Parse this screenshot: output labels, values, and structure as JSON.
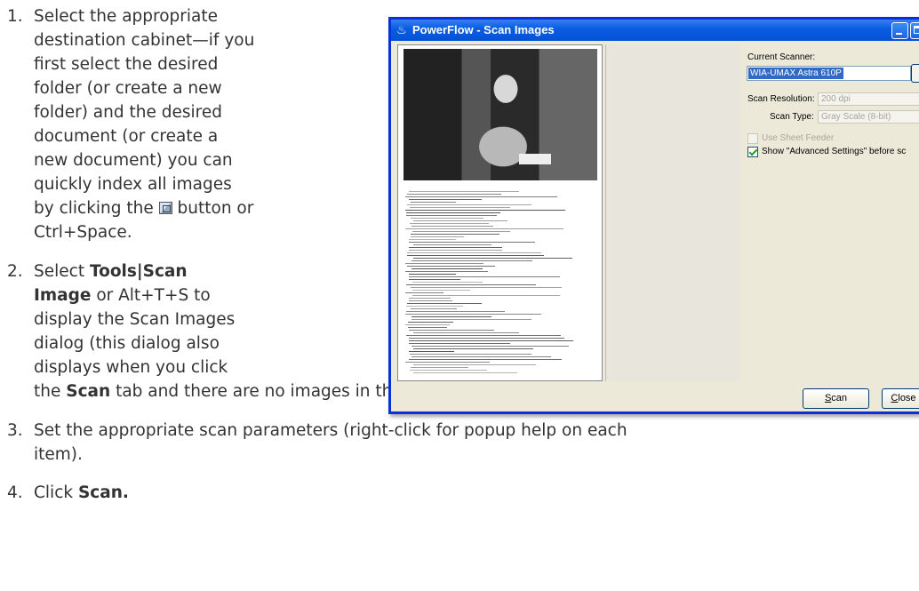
{
  "steps": [
    {
      "number": "1.",
      "lines": [
        "Select the appropriate",
        "destination cabinet—if you",
        "first select the desired",
        "folder (or create a new",
        "folder) and the desired",
        "document (or create a",
        "new document) you can",
        "quickly index all images"
      ],
      "line9_a": "by clicking the ",
      "line9_icon": "index-icon",
      "line9_b": " button or",
      "line10": "Ctrl+Space."
    },
    {
      "number": "2.",
      "l1_a": "Select ",
      "l1_bold": "Tools|Scan",
      "l2_bold": "Image",
      "l2_b": " or Alt+T+S to",
      "l3": "display the Scan Images",
      "l4": "dialog (this dialog also",
      "l5": "displays when you click",
      "l6_a": "the ",
      "l6_bold": "Scan",
      "l6_b": " tab and there are no images in the list)."
    },
    {
      "number": "3.",
      "l1": "Set the appropriate scan parameters (right-click for popup help on each",
      "l2": "item)."
    },
    {
      "number": "4.",
      "l1_a": "Click ",
      "l1_bold": "Scan."
    }
  ],
  "dialog": {
    "title": "PowerFlow - Scan Images",
    "current_scanner_label": "Current Scanner:",
    "current_scanner_value": "WIA-UMAX Astra 610P",
    "scan_resolution_label": "Scan Resolution:",
    "scan_resolution_value": "200 dpi",
    "scan_type_label": "Scan Type:",
    "scan_type_value": "Gray Scale (8-bit)",
    "use_sheet_feeder_label": "Use Sheet Feeder",
    "use_sheet_feeder_checked": false,
    "show_advanced_label": "Show \"Advanced Settings\" before sc",
    "show_advanced_checked": true,
    "scan_button_first": "S",
    "scan_button_rest": "can",
    "close_button_first": "C",
    "close_button_rest": "lose",
    "accent_color": "#0a5ee0",
    "selection_color": "#316ac5"
  }
}
